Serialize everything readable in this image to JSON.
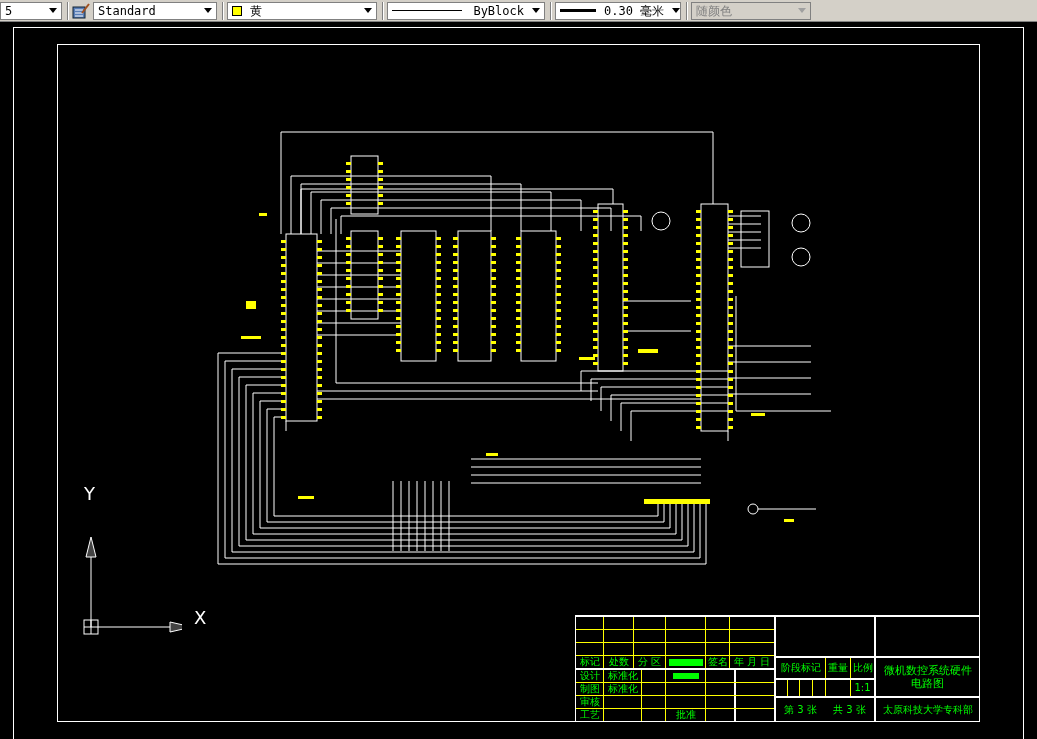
{
  "toolbar": {
    "controls": [
      {
        "kind": "text",
        "value": "5",
        "disabled": false
      },
      {
        "kind": "style",
        "value": "Standard",
        "disabled": false
      },
      {
        "kind": "color",
        "value": "黄",
        "color": "#ffff00",
        "disabled": false
      },
      {
        "kind": "linetype",
        "value": "ByBlock",
        "disabled": false
      },
      {
        "kind": "lineweight",
        "value": "0.30 毫米",
        "disabled": false
      },
      {
        "kind": "plotstyle",
        "value": "随颜色",
        "disabled": true
      }
    ]
  },
  "ucs": {
    "x_label": "X",
    "y_label": "Y"
  },
  "title_block": {
    "revision_headers": [
      "标记",
      "处数",
      "分 区",
      "签名",
      "年 月 日"
    ],
    "sign_rows": [
      {
        "role": "设计",
        "note": "标准化"
      },
      {
        "role": "制图",
        "note": "标准化"
      },
      {
        "role": "审核"
      },
      {
        "role": "工艺",
        "approve": "批准"
      }
    ],
    "stage_label": "阶段标记",
    "weight_label": "重量",
    "scale_label": "比例",
    "scale": "1:1",
    "sheet_number": "第 3 张",
    "sheet_count": "共 3 张",
    "title": "微机数控系统硬件电路图",
    "org": "太原科技大学专科部"
  }
}
